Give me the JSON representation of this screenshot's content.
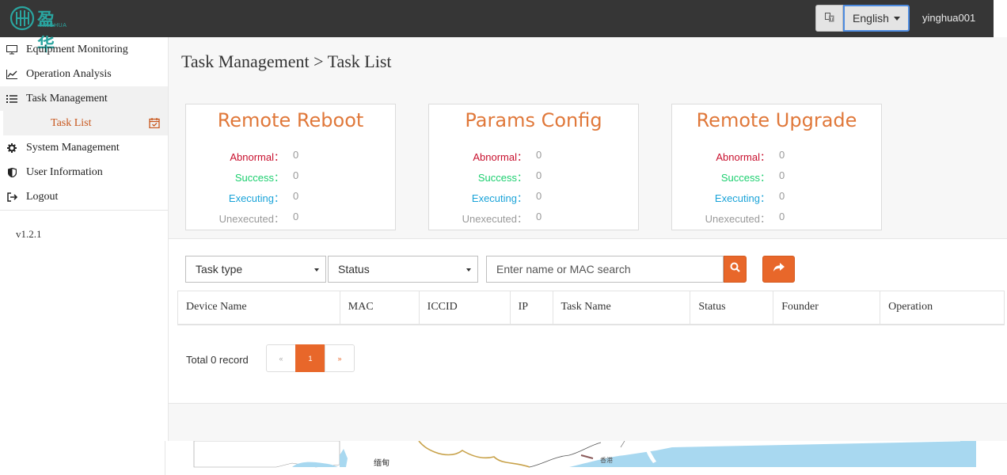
{
  "header": {
    "logo_cn": "盈华",
    "logo_en": "YINGHUA",
    "language": "English",
    "username": "yinghua001"
  },
  "sidebar": {
    "items": [
      {
        "label": "Equipment Monitoring",
        "icon": "monitor-icon"
      },
      {
        "label": "Operation Analysis",
        "icon": "line-chart-icon"
      },
      {
        "label": "Task Management",
        "icon": "list-icon"
      },
      {
        "label": "System Management",
        "icon": "gear-icon"
      },
      {
        "label": "User Information",
        "icon": "shield-icon"
      },
      {
        "label": "Logout",
        "icon": "logout-icon"
      }
    ],
    "sub_item": {
      "label": "Task List",
      "icon": "calendar-check-icon"
    },
    "version": "v1.2.1"
  },
  "page": {
    "title": "Task Management > Task List"
  },
  "stats_cards": [
    {
      "title": "Remote Reboot",
      "abnormal_label": "Abnormal：",
      "abnormal": "0",
      "success_label": "Success：",
      "success": "0",
      "executing_label": "Executing：",
      "executing": "0",
      "unexecuted_label": "Unexecuted：",
      "unexecuted": "0"
    },
    {
      "title": "Params Config",
      "abnormal_label": "Abnormal：",
      "abnormal": "0",
      "success_label": "Success：",
      "success": "0",
      "executing_label": "Executing：",
      "executing": "0",
      "unexecuted_label": "Unexecuted：",
      "unexecuted": "0"
    },
    {
      "title": "Remote Upgrade",
      "abnormal_label": "Abnormal：",
      "abnormal": "0",
      "success_label": "Success：",
      "success": "0",
      "executing_label": "Executing：",
      "executing": "0",
      "unexecuted_label": "Unexecuted：",
      "unexecuted": "0"
    }
  ],
  "filters": {
    "task_type": "Task type",
    "status": "Status",
    "search_placeholder": "Enter name or MAC search"
  },
  "table": {
    "columns": [
      "Device Name",
      "MAC",
      "ICCID",
      "IP",
      "Task Name",
      "Status",
      "Founder",
      "Operation"
    ]
  },
  "pagination": {
    "total": "Total 0 record",
    "prev": "«",
    "current": "1",
    "next": "»"
  },
  "map": {
    "labels": [
      "缅甸",
      "香港"
    ]
  },
  "colors": {
    "accent": "#e8672a",
    "topbar": "#363636",
    "abnormal": "#c8102e",
    "success": "#1ccf6f",
    "executing": "#1aa3d8"
  }
}
